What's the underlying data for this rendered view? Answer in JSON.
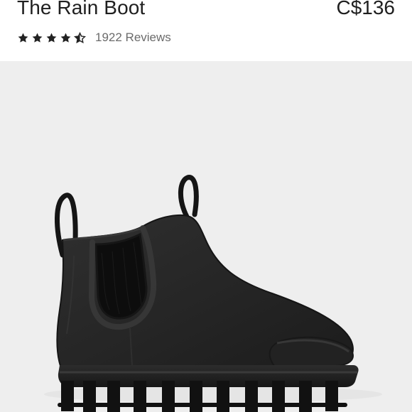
{
  "product": {
    "title": "The Rain Boot",
    "price": "C$136",
    "rating": {
      "value": 4.5,
      "max": 5,
      "reviews_label": "1922 Reviews"
    },
    "image": {
      "icon": "rain-boot-product-image",
      "colors": {
        "boot": "#242424",
        "background": "#eeeeee"
      }
    }
  }
}
